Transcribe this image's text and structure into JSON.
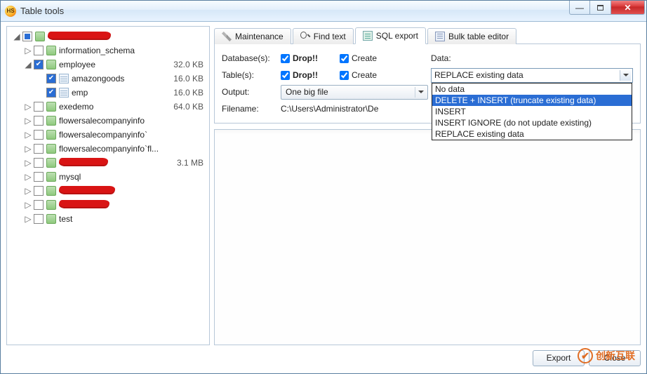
{
  "window": {
    "title": "Table tools"
  },
  "tabs": {
    "maintenance": "Maintenance",
    "find_text": "Find text",
    "sql_export": "SQL export",
    "bulk_editor": "Bulk table editor",
    "active": "sql_export"
  },
  "export_form": {
    "databases_label": "Database(s):",
    "tables_label": "Table(s):",
    "output_label": "Output:",
    "filename_label": "Filename:",
    "drop_label": "Drop!!",
    "create_label": "Create",
    "data_label": "Data:",
    "db_drop_checked": true,
    "db_create_checked": true,
    "tbl_drop_checked": true,
    "tbl_create_checked": true,
    "output_value": "One big file",
    "filename_value": "C:\\Users\\Administrator\\De",
    "data_select_value": "REPLACE existing data",
    "data_options": [
      "No data",
      "DELETE + INSERT (truncate existing data)",
      "INSERT",
      "INSERT IGNORE (do not update existing)",
      "REPLACE existing data"
    ],
    "data_highlighted_index": 1
  },
  "tree": {
    "root_checked": "mixed",
    "items": [
      {
        "level": 2,
        "twist": "▷",
        "checked": false,
        "icon": "cyl",
        "label": "information_schema",
        "size": ""
      },
      {
        "level": 2,
        "twist": "◢",
        "checked": true,
        "icon": "cyl",
        "label": "employee",
        "size": "32.0 KB"
      },
      {
        "level": 3,
        "twist": "",
        "checked": true,
        "icon": "tbl",
        "label": "amazongoods",
        "size": "16.0 KB"
      },
      {
        "level": 3,
        "twist": "",
        "checked": true,
        "icon": "tbl",
        "label": "emp",
        "size": "16.0 KB"
      },
      {
        "level": 2,
        "twist": "▷",
        "checked": false,
        "icon": "cyl",
        "label": "exedemo",
        "size": "64.0 KB"
      },
      {
        "level": 2,
        "twist": "▷",
        "checked": false,
        "icon": "cyl",
        "label": "flowersalecompanyinfo",
        "size": ""
      },
      {
        "level": 2,
        "twist": "▷",
        "checked": false,
        "icon": "cyl",
        "label": "flowersalecompanyinfo`",
        "size": ""
      },
      {
        "level": 2,
        "twist": "▷",
        "checked": false,
        "icon": "cyl",
        "label": "flowersalecompanyinfo`fl...",
        "size": ""
      },
      {
        "level": 2,
        "twist": "▷",
        "checked": false,
        "icon": "cyl",
        "label": "",
        "redact": 70,
        "size": "3.1 MB"
      },
      {
        "level": 2,
        "twist": "▷",
        "checked": false,
        "icon": "cyl",
        "label": "mysql",
        "size": ""
      },
      {
        "level": 2,
        "twist": "▷",
        "checked": false,
        "icon": "cyl",
        "label": "",
        "redact": 80,
        "size": ""
      },
      {
        "level": 2,
        "twist": "▷",
        "checked": false,
        "icon": "cyl",
        "label": "",
        "redact": 72,
        "size": ""
      },
      {
        "level": 2,
        "twist": "▷",
        "checked": false,
        "icon": "cyl",
        "label": "test",
        "size": ""
      }
    ]
  },
  "buttons": {
    "export": "Export",
    "close": "Close"
  },
  "watermark": "创新互联"
}
